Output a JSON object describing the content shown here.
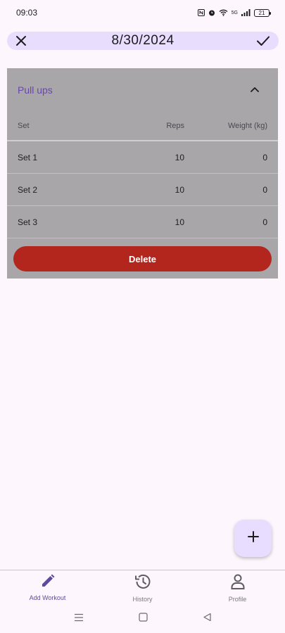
{
  "status_bar": {
    "time": "09:03",
    "network_label": "5G",
    "battery_level": "21"
  },
  "top_bar": {
    "date": "8/30/2024",
    "close_icon": "close-icon",
    "confirm_icon": "check-icon"
  },
  "workout_card": {
    "exercise_name": "Pull ups",
    "collapse_icon": "chevron-up-icon",
    "columns": {
      "set": "Set",
      "reps": "Reps",
      "weight": "Weight (kg)"
    },
    "rows": [
      {
        "set": "Set 1",
        "reps": "10",
        "weight": "0"
      },
      {
        "set": "Set 2",
        "reps": "10",
        "weight": "0"
      },
      {
        "set": "Set 3",
        "reps": "10",
        "weight": "0"
      }
    ],
    "delete_label": "Delete"
  },
  "fab": {
    "icon": "plus-icon"
  },
  "bottom_nav": {
    "items": [
      {
        "label": "Add Workout",
        "icon": "pencil-icon",
        "active": true
      },
      {
        "label": "History",
        "icon": "history-icon",
        "active": false
      },
      {
        "label": "Profile",
        "icon": "person-icon",
        "active": false
      }
    ]
  },
  "colors": {
    "accent": "#6848a8",
    "top_bar_bg": "#e9ddfe",
    "delete": "#b3261e",
    "card_overlay": "#a8a6a9"
  }
}
